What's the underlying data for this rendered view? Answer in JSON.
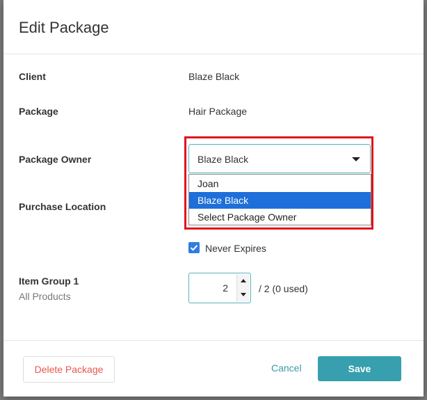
{
  "modal": {
    "title": "Edit Package"
  },
  "fields": {
    "client": {
      "label": "Client",
      "value": "Blaze Black"
    },
    "package": {
      "label": "Package",
      "value": "Hair Package"
    },
    "package_owner": {
      "label": "Package Owner",
      "selected": "Blaze Black",
      "options": [
        "Joan",
        "Blaze Black",
        "Select Package Owner"
      ],
      "highlighted_option": "Blaze Black"
    },
    "purchase_location": {
      "label": "Purchase Location"
    },
    "never_expires": {
      "label": "Never Expires",
      "checked": true
    },
    "item_group": {
      "label": "Item Group 1",
      "sublabel": "All Products",
      "quantity": "2",
      "usage": "/ 2 (0 used)"
    }
  },
  "footer": {
    "delete_label": "Delete Package",
    "cancel_label": "Cancel",
    "save_label": "Save"
  },
  "colors": {
    "accent": "#379fae",
    "danger_text": "#e8574f",
    "highlight_border": "#e0131b",
    "selected_option": "#1e6fd9"
  }
}
